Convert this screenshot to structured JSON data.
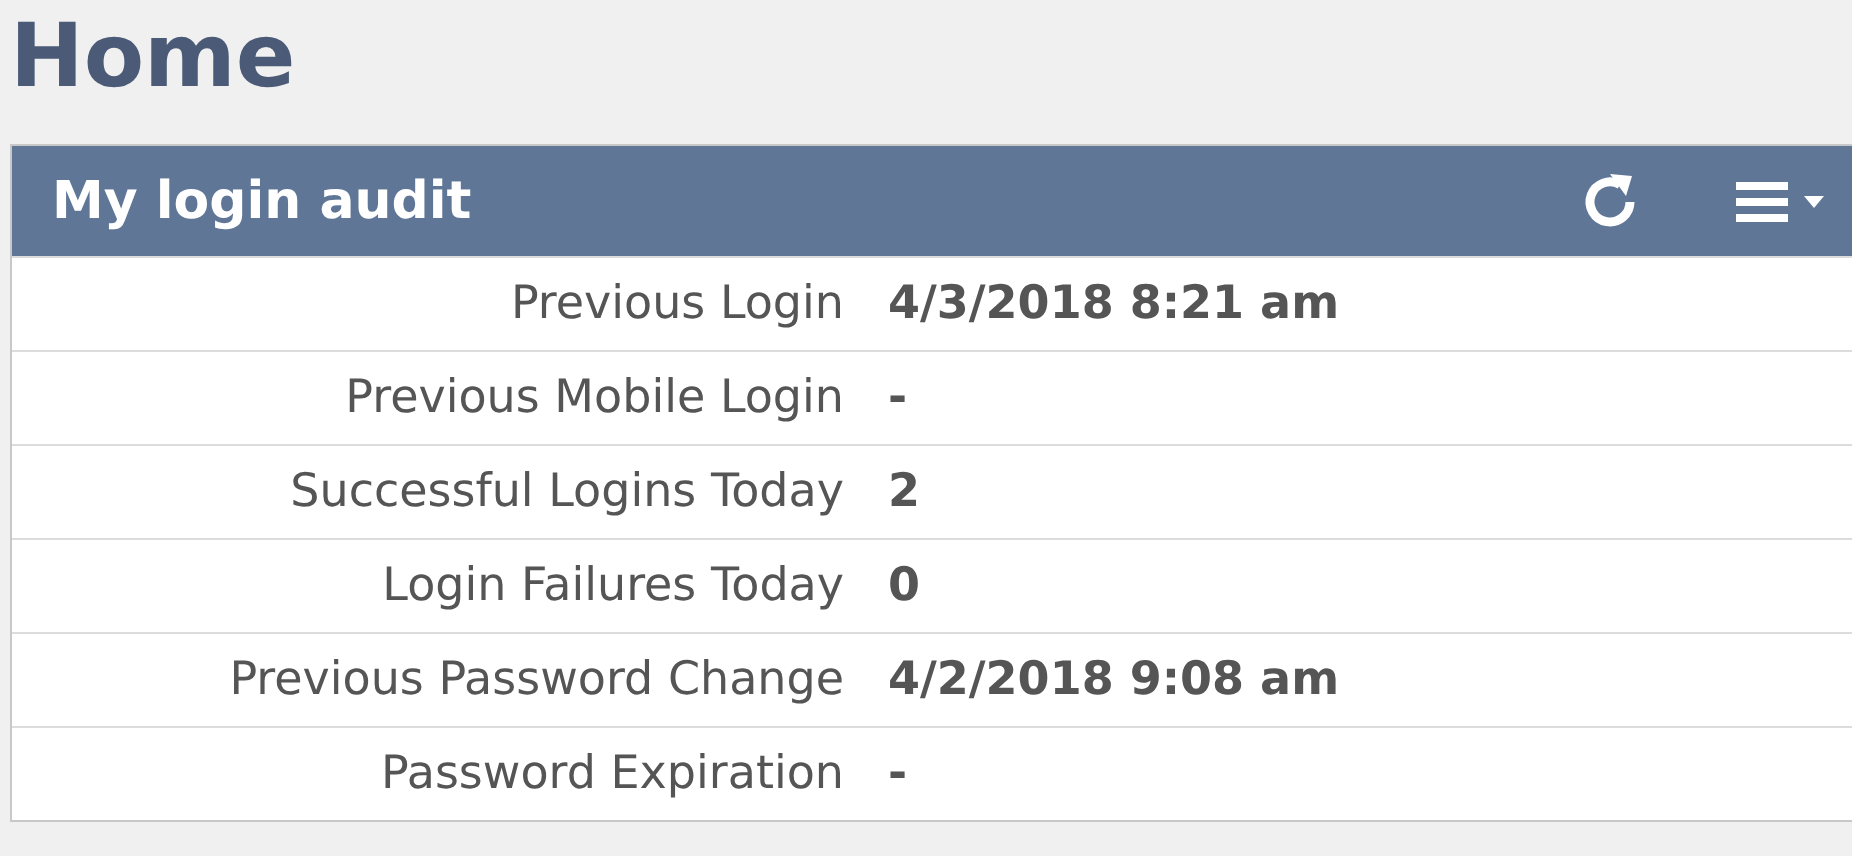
{
  "page": {
    "title": "Home"
  },
  "panel": {
    "title": "My login audit",
    "rows": [
      {
        "label": "Previous Login",
        "value": "4/3/2018 8:21 am"
      },
      {
        "label": "Previous Mobile Login",
        "value": "-"
      },
      {
        "label": "Successful Logins Today",
        "value": "2"
      },
      {
        "label": "Login Failures Today",
        "value": "0"
      },
      {
        "label": "Previous Password Change",
        "value": "4/2/2018 9:08 am"
      },
      {
        "label": "Password Expiration",
        "value": "-"
      }
    ]
  }
}
